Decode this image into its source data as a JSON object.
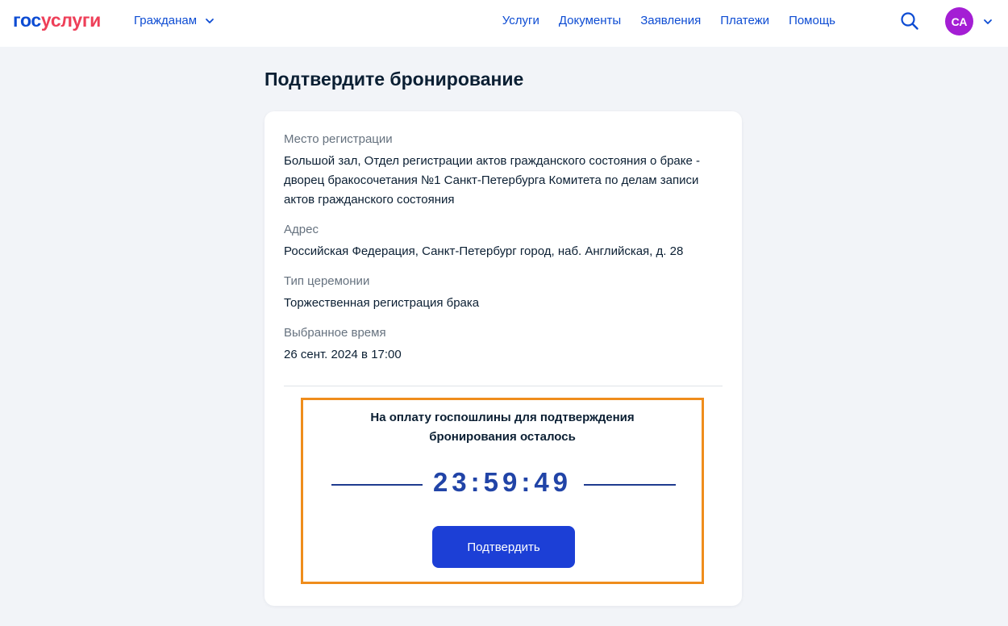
{
  "header": {
    "logo": {
      "part1": "гос",
      "part2": "услуги"
    },
    "audience_menu": "Гражданам",
    "nav": [
      "Услуги",
      "Документы",
      "Заявления",
      "Платежи",
      "Помощь"
    ],
    "avatar_initials": "СА"
  },
  "page": {
    "title": "Подтвердите бронирование"
  },
  "booking": {
    "place": {
      "label": "Место регистрации",
      "value": "Большой зал, Отдел регистрации актов гражданского состояния о браке - дворец бракосочетания №1 Санкт-Петербурга Комитета по делам записи актов гражданского состояния"
    },
    "address": {
      "label": "Адрес",
      "value": "Российская Федерация, Санкт-Петербург город, наб. Английская, д. 28"
    },
    "ceremony": {
      "label": "Тип церемонии",
      "value": "Торжественная регистрация брака"
    },
    "time": {
      "label": "Выбранное время",
      "value": "26 сент. 2024 в 17:00"
    }
  },
  "timer": {
    "line1": "На оплату госпошлины для подтверждения",
    "line2": "бронирования осталось",
    "value": "23:59:49",
    "confirm_label": "Подтвердить"
  },
  "colors": {
    "brand_blue": "#0d4cd3",
    "brand_red": "#ee3f58",
    "avatar": "#a41ed4",
    "highlight_border": "#ef8d1c",
    "button": "#1c3fd6"
  },
  "icons": {
    "search": "search-icon",
    "chevron": "chevron-down-icon"
  }
}
